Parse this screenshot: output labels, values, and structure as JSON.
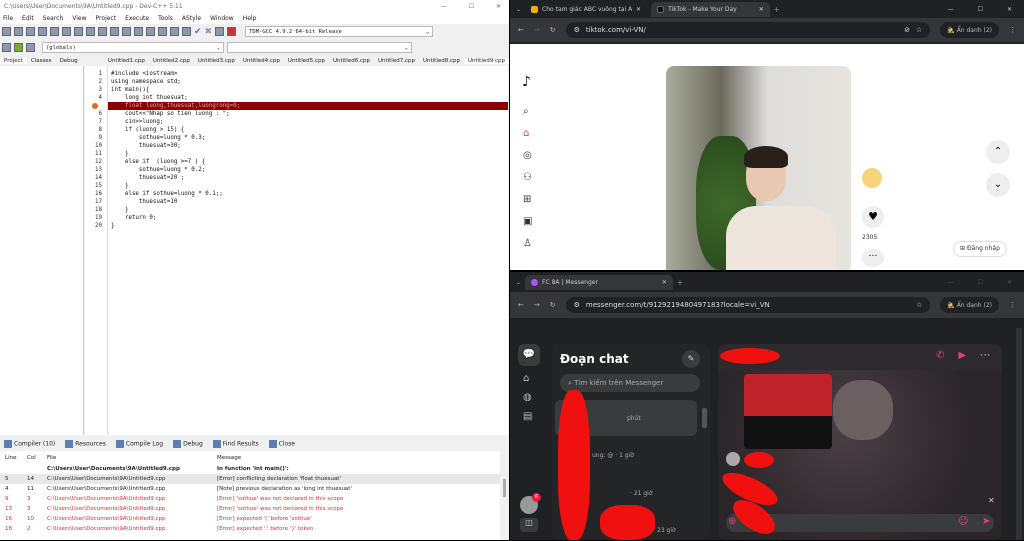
{
  "devcpp": {
    "title": "C:\\Users\\User\\Documents\\9A\\Untitled9.cpp - Dev-C++ 5.11",
    "menu": [
      "File",
      "Edit",
      "Search",
      "View",
      "Project",
      "Execute",
      "Tools",
      "AStyle",
      "Window",
      "Help"
    ],
    "compiler_select": "TDM-GCC 4.9.2 64-bit Release",
    "scope_select": "(globals)",
    "panel_tabs": [
      "Project",
      "Classes",
      "Debug"
    ],
    "file_tabs": [
      "Untitled1.cpp",
      "Untitled2.cpp",
      "Untitled3.cpp",
      "Untitled4.cpp",
      "Untitled5.cpp",
      "Untitled6.cpp",
      "Untitled7.cpp",
      "Untitled8.cpp",
      "Untitled9.cpp"
    ],
    "code": [
      "#include <iostream>",
      "using namespace std;",
      "int main(){",
      "    long int thuesuat;",
      "    float luong,thuesuat,luongrong=0;",
      "    cout<<\"Nhap so tien luong : \";",
      "    cin>>luong;",
      "    if (luong > 15) {",
      "        sothue=luong * 0.3;",
      "        thuesuat=30;",
      "    }",
      "    else if  (luong >=7 ) {",
      "        sothue=luong * 0.2;",
      "        thuesuat=20 ;",
      "    }",
      "    else if sothue=luong * 0.1;;",
      "        thuesuat=10",
      "    }",
      "    return 0;",
      "}"
    ],
    "error_line": 5,
    "bottom_tabs": [
      "Compiler (10)",
      "Resources",
      "Compile Log",
      "Debug",
      "Find Results",
      "Close"
    ],
    "table_headers": [
      "Line",
      "Col",
      "File",
      "Message"
    ],
    "rows": [
      {
        "line": "",
        "col": "",
        "file": "C:\\Users\\User\\Documents\\9A\\Untitled9.cpp",
        "msg": "In function 'int main()':",
        "style": "bold"
      },
      {
        "line": "5",
        "col": "14",
        "file": "C:\\Users\\User\\Documents\\9A\\Untitled9.cpp",
        "msg": "[Error] conflicting declaration 'float thuesuat'",
        "style": "sel"
      },
      {
        "line": "4",
        "col": "11",
        "file": "C:\\Users\\User\\Documents\\9A\\Untitled9.cpp",
        "msg": "[Note] previous declaration as 'long int thuesuat'",
        "style": "normal"
      },
      {
        "line": "9",
        "col": "3",
        "file": "C:\\Users\\User\\Documents\\9A\\Untitled9.cpp",
        "msg": "[Error] 'sothue' was not declared in this scope",
        "style": "red"
      },
      {
        "line": "13",
        "col": "3",
        "file": "C:\\Users\\User\\Documents\\9A\\Untitled9.cpp",
        "msg": "[Error] 'sothue' was not declared in this scope",
        "style": "red"
      },
      {
        "line": "16",
        "col": "10",
        "file": "C:\\Users\\User\\Documents\\9A\\Untitled9.cpp",
        "msg": "[Error] expected '(' before 'sothue'",
        "style": "red"
      },
      {
        "line": "18",
        "col": "2",
        "file": "C:\\Users\\User\\Documents\\9A\\Untitled9.cpp",
        "msg": "[Error] expected ';' before '}' token",
        "style": "red"
      }
    ]
  },
  "tiktok": {
    "tabs": [
      "Cho tam giác ABC vuông tại A",
      "TikTok - Make Your Day"
    ],
    "url": "tiktok.com/vi-VN/",
    "incognito": "Ẩn danh (2)",
    "like_count": "2305",
    "login": "Đăng nhập"
  },
  "messenger": {
    "tab": "FC 8A | Messenger",
    "url": "messenger.com/t/9129219480497183?locale=vi_VN",
    "incognito": "Ẩn danh (2)",
    "heading": "Đoạn chat",
    "search_placeholder": "Tìm kiếm trên Messenger",
    "chat_times": [
      "phút",
      "ung: @ · 1 giờ",
      "· 21 giờ",
      "23 giờ"
    ],
    "badge": "6",
    "accent": "#0084ff"
  }
}
